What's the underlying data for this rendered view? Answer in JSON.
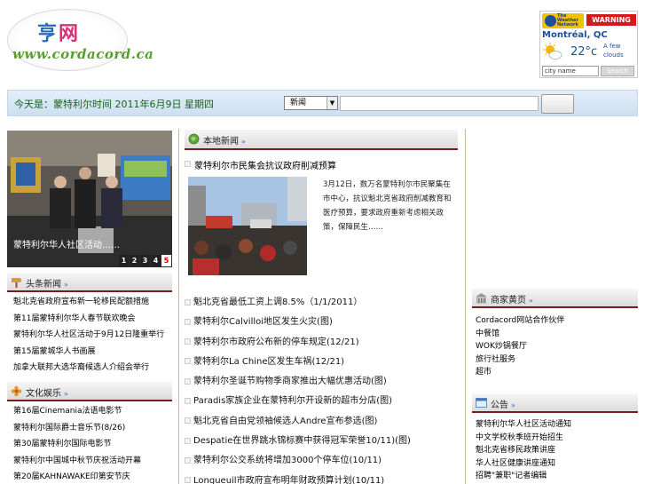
{
  "logo": {
    "cn_part1": "亨",
    "cn_part2": "网",
    "url": "www.cordacord.ca"
  },
  "weather": {
    "brand": "The Weather Network",
    "warning": "WARNING",
    "city": "Montréal, QC",
    "temp": "22°c",
    "condition_line1": "A few",
    "condition_line2": "clouds",
    "city_placeholder": "city name",
    "search_label": "Search",
    "icon": "sun-cloud-icon"
  },
  "nav": {
    "date_text": "今天是：蒙特利尔时间 2011年6月9日 星期四",
    "select_value": "新闻",
    "search_value": ""
  },
  "left": {
    "photo_caption": "蒙特利尔华人社区活动……",
    "pager": [
      "1",
      "2",
      "3",
      "4",
      "5"
    ],
    "active_page": "5",
    "section1_title": "头条新闻",
    "section1_items": [
      "魁北克省政府宣布新一轮移民配额措施",
      "第11届蒙特利尔华人春节联欢晚会",
      "蒙特利尔华人社区活动于9月12日隆重举行",
      "第15届蒙城华人书画展",
      "加拿大联邦大选华裔候选人介绍会举行"
    ],
    "section2_title": "文化娱乐",
    "section2_items": [
      "第16届Cinemania法语电影节",
      "蒙特利尔国际爵士音乐节(8/26)",
      "第30届蒙特利尔国际电影节",
      "蒙特利尔中国城中秋节庆祝活动开幕",
      "第20届KAHNAWAKE印第安节庆"
    ]
  },
  "middle": {
    "section_title": "本地新闻",
    "feature_title": "蒙特利尔市民集会抗议政府削减预算",
    "feature_body": "3月12日，数万名蒙特利尔市民聚集在市中心，抗议魁北克省政府削减教育和医疗预算，要求政府重新考虑相关政策，保障民生……",
    "news": [
      "魁北克省最低工资上调8.5%（1/1/2011）",
      "蒙特利尔Calvilloi地区发生火灾(图)",
      "蒙特利尔市政府公布新的停车规定(12/21)",
      "蒙特利尔La Chine区发生车祸(12/21)",
      "蒙特利尔圣诞节购物季商家推出大幅优惠活动(图)",
      "Paradis家族企业在蒙特利尔开设新的超市分店(图)",
      "魁北克省自由党领袖候选人Andre宣布参选(图)",
      "Despatie在世界跳水锦标赛中获得冠军荣誉10/11)(图)",
      "蒙特利尔公交系统将增加3000个停车位(10/11)",
      "Longueuil市政府宣布明年财政预算计划(10/11)"
    ]
  },
  "right": {
    "section1_title": "商家黄页",
    "section1_items": [
      "Cordacord网站合作伙伴",
      "中餐馆",
      "WOK炒锅餐厅",
      "旅行社服务",
      "超市"
    ],
    "section2_title": "公告",
    "section2_items": [
      "蒙特利尔华人社区活动通知",
      "中文学校秋季班开始招生",
      "魁北克省移民政策讲座",
      "华人社区健康讲座通知",
      "招聘\"兼职\"记者编辑"
    ]
  }
}
